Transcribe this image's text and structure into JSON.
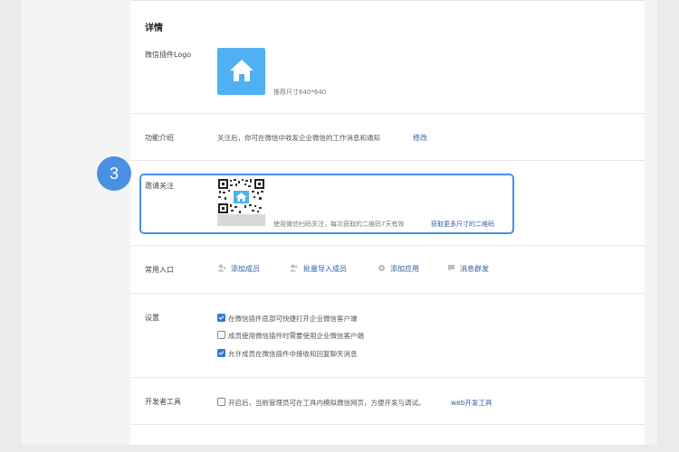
{
  "section_title": "详情",
  "logo_row": {
    "label": "微信插件Logo",
    "size_hint": "推荐尺寸640*640",
    "logo_icon": "home-icon",
    "logo_color": "#4fb0f2"
  },
  "intro_row": {
    "label": "功能介绍",
    "text": "关注后，你可在微信中收发企业微信的工作消息和通知",
    "edit_link": "修改"
  },
  "invite_row": {
    "label": "邀请关注",
    "qr_note": "使用微信扫码关注，每次获取的二维码7天有效",
    "more_link": "获取更多尺寸的二维码",
    "step_number": "3",
    "highlight_color": "#4a90e2"
  },
  "entry_row": {
    "label": "常用入口",
    "items": [
      {
        "icon": "add-user-icon",
        "label": "添加成员"
      },
      {
        "icon": "batch-import-icon",
        "label": "批量导入成员"
      },
      {
        "icon": "add-app-icon",
        "label": "添加应用"
      },
      {
        "icon": "message-icon",
        "label": "消息群发"
      }
    ]
  },
  "settings_row": {
    "label": "设置",
    "options": [
      {
        "text": "在微信插件底部可快捷打开企业微信客户端",
        "checked": true
      },
      {
        "text": "成员使用微信插件时需要使用企业微信客户端",
        "checked": false
      },
      {
        "text": "允许成员在微信插件中接收和回复聊天消息",
        "checked": true
      }
    ]
  },
  "devtools_row": {
    "label": "开发者工具",
    "text": "开启后，当前管理员可在工具内模拟微信网页，方便开发与调试。",
    "link": "web开发工具",
    "checked": false
  },
  "colors": {
    "link": "#2f5fa8",
    "checkbox_checked": "#2f7ad8"
  }
}
